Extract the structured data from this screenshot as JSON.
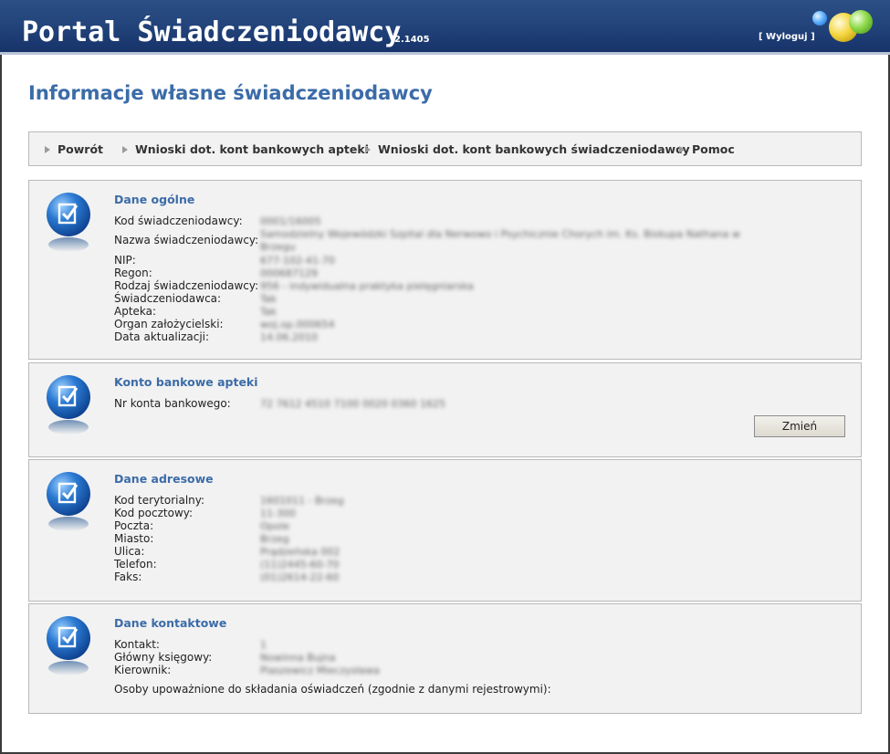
{
  "header": {
    "title": "Portal Świadczeniodawcy",
    "version": "2.1405",
    "logout": "[ Wyloguj ]"
  },
  "page_title": "Informacje własne świadczeniodawcy",
  "nav": [
    {
      "label": "Powrót"
    },
    {
      "label": "Wnioski dot. kont bankowych apteki"
    },
    {
      "label": "Wnioski dot. kont bankowych świadczeniodawcy"
    },
    {
      "label": "Pomoc"
    }
  ],
  "sections": {
    "general": {
      "title": "Dane ogólne",
      "rows": [
        {
          "label": "Kod świadczeniodawcy:",
          "value": "0001/16005"
        },
        {
          "label": "Nazwa świadczeniodawcy:",
          "value": "Samodzielny Wojewódzki Szpital dla Nerwowo i Psychicznie Chorych im. Ks. Biskupa Nathana w",
          "value2": "Brzegu"
        },
        {
          "label": "NIP:",
          "value": "677-102-41-70"
        },
        {
          "label": "Regon:",
          "value": "000687129"
        },
        {
          "label": "Rodzaj świadczeniodawcy:",
          "value": "956 - indywidualna praktyka pielęgniarska"
        },
        {
          "label": "Świadczeniodawca:",
          "value": "Tak"
        },
        {
          "label": "Apteka:",
          "value": "Tak"
        },
        {
          "label": "Organ założycielski:",
          "value": "woj.op.000654"
        },
        {
          "label": "Data aktualizacji:",
          "value": "14.06.2010"
        }
      ]
    },
    "bank": {
      "title": "Konto bankowe apteki",
      "rows": [
        {
          "label": "Nr konta bankowego:",
          "value": "72 7612 4510 7100 0020 0360 1625"
        }
      ],
      "change_button": "Zmień"
    },
    "address": {
      "title": "Dane adresowe",
      "rows": [
        {
          "label": "Kod terytorialny:",
          "value": "1601011 - Brzeg"
        },
        {
          "label": "Kod pocztowy:",
          "value": "11-300"
        },
        {
          "label": "Poczta:",
          "value": "Opole"
        },
        {
          "label": "Miasto:",
          "value": "Brzeg"
        },
        {
          "label": "Ulica:",
          "value": "Prądzeńska 002"
        },
        {
          "label": "Telefon:",
          "value": "(11)2445-60-70"
        },
        {
          "label": "Faks:",
          "value": "(01)2614-22-60"
        }
      ]
    },
    "contact": {
      "title": "Dane kontaktowe",
      "rows": [
        {
          "label": "Kontakt:",
          "value": "1"
        },
        {
          "label": "Główny księgowy:",
          "value": "Nowinna Bujna"
        },
        {
          "label": "Kierownik:",
          "value": "Piaszewicz Mieczysława"
        }
      ],
      "authorized_note": "Osoby upoważnione do składania oświadczeń (zgodnie z danymi rejestrowymi):"
    }
  }
}
